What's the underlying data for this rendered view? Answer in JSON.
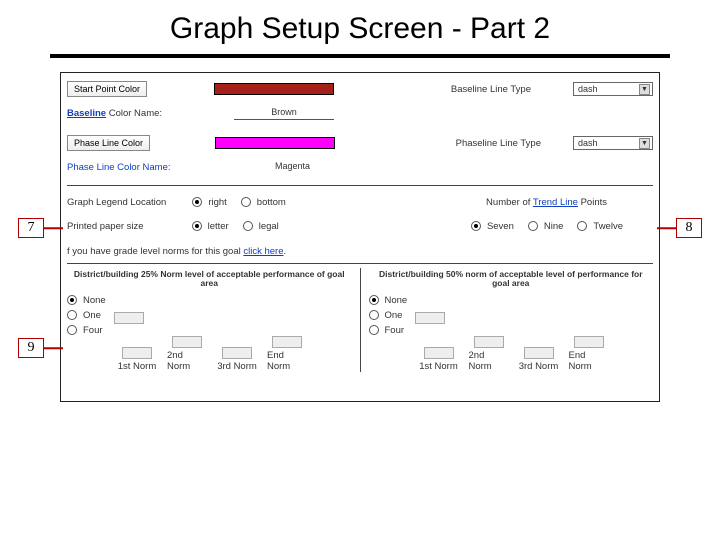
{
  "title": "Graph Setup Screen - Part 2",
  "start_color_btn": "Start Point Color",
  "baseline_color_name_lbl": "Baseline",
  "baseline_color_name_suffix": " Color Name:",
  "baseline_color_val": "Brown",
  "baseline_line_type_lbl": "Baseline Line Type",
  "baseline_line_type_val": "dash",
  "phase_color_btn": "Phase Line Color",
  "phase_color_name_lbl": "Phase Line Color Name:",
  "phase_color_val": "Magenta",
  "phaseline_line_type_lbl": "Phaseline Line Type",
  "phaseline_line_type_val": "dash",
  "legend_loc_lbl": "Graph Legend Location",
  "legend_opts": {
    "right": "right",
    "bottom": "bottom"
  },
  "trend_points_lbl_prefix": "Number of ",
  "trend_points_link": "Trend Line",
  "trend_points_lbl_suffix": " Points",
  "paper_size_lbl": "Printed paper size",
  "paper_opts": {
    "letter": "letter",
    "legal": "legal"
  },
  "count_opts": {
    "seven": "Seven",
    "nine": "Nine",
    "twelve": "Twelve"
  },
  "grade_norms_text": "f you have grade level norms for this goal ",
  "click_here": "click here",
  "norm25_head": "District/building 25% Norm level of acceptable performance of goal area",
  "norm50_head": "District/building 50% norm of acceptable level of performance for goal area",
  "norm_opts": {
    "none": "None",
    "one": "One",
    "four": "Four"
  },
  "norm_cols": {
    "n1": "1st Norm",
    "n2": "2nd Norm",
    "n3": "3rd Norm",
    "n4": "End Norm"
  },
  "callouts": {
    "c7": "7",
    "c8": "8",
    "c9": "9"
  }
}
